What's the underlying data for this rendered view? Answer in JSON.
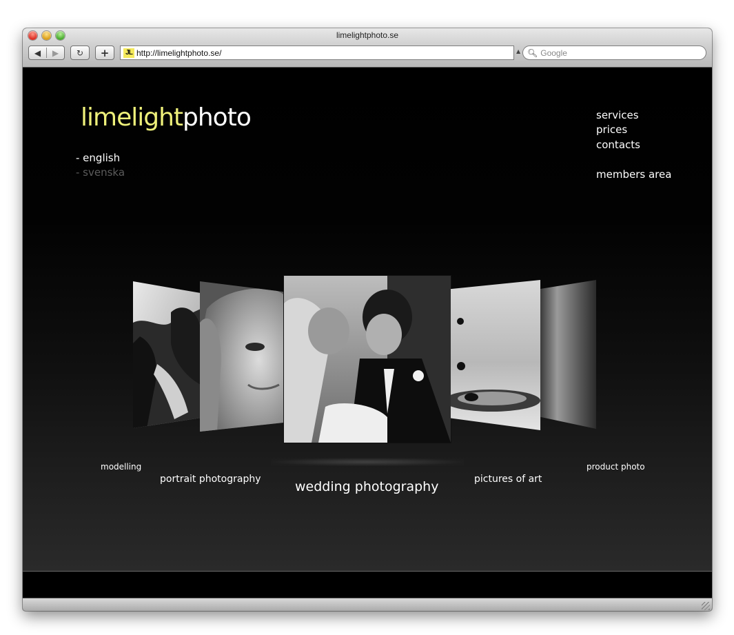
{
  "window": {
    "title": "limelightphoto.se"
  },
  "toolbar": {
    "back_icon": "back-arrow-icon",
    "forward_icon": "forward-arrow-icon",
    "reload_glyph": "↻",
    "add_glyph": "+",
    "address": "http://limelightphoto.se/",
    "favicon_text": "JL",
    "search_placeholder": "Google"
  },
  "site": {
    "logo_lime": "limelight",
    "logo_photo": "photo",
    "languages": [
      "- english",
      "- svenska"
    ],
    "nav": [
      "services",
      "prices",
      "contacts",
      "members area"
    ],
    "gallery": [
      "modelling",
      "portrait photography",
      "wedding photography",
      "pictures of art",
      "product photo"
    ]
  },
  "colors": {
    "logo_accent": "#eef07a",
    "page_background": "#000000",
    "inactive_language": "#5c5c5c"
  }
}
